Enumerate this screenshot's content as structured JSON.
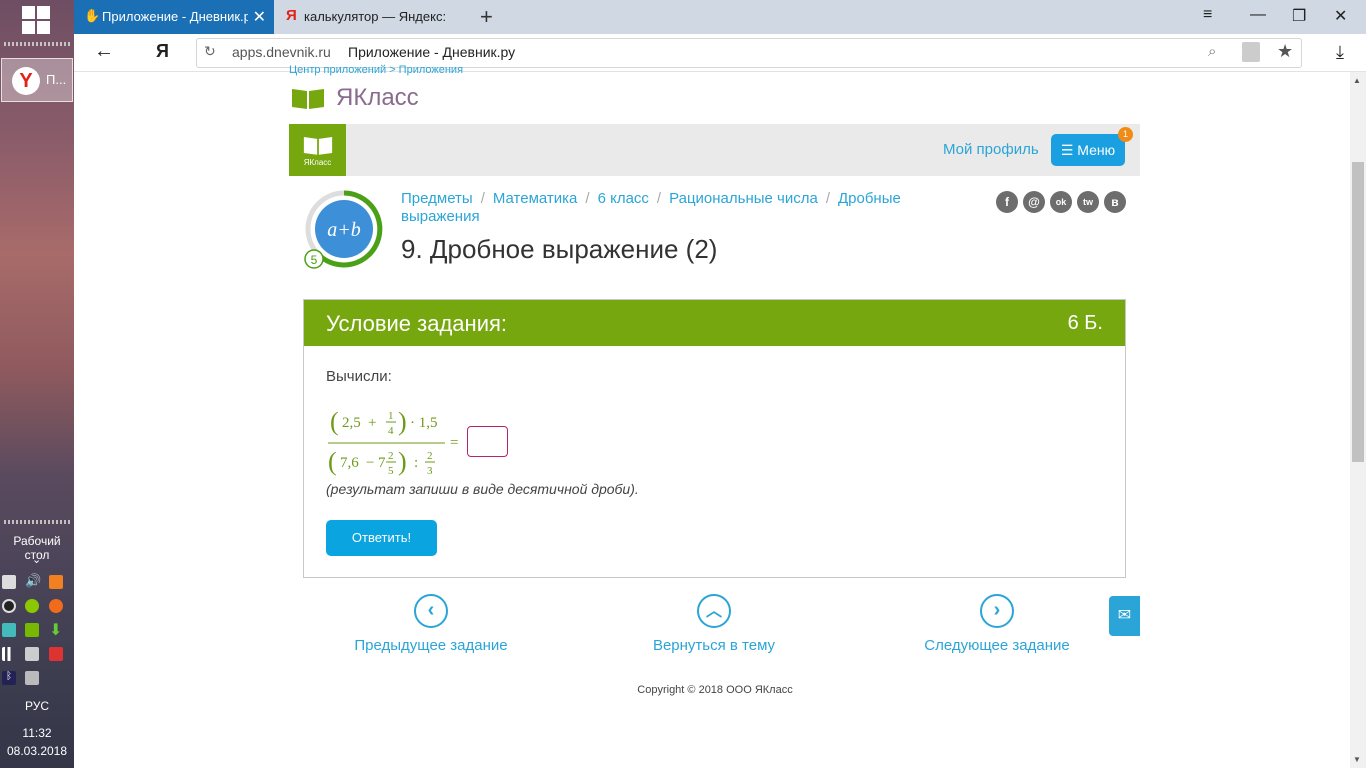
{
  "browser": {
    "tabs": [
      {
        "label": "Приложение - Дневник.р",
        "active": true
      },
      {
        "label": "калькулятор — Яндекс: на",
        "active": false
      }
    ],
    "url_host": "apps.dnevnik.ru",
    "url_title": "Приложение - Дневник.ру",
    "yandex_letter": "Я"
  },
  "taskbar": {
    "app_label": "П...",
    "desktop_label": "Рабочий стол",
    "lang": "РУС",
    "time": "11:32",
    "date": "08.03.2018"
  },
  "site": {
    "top_crumbs": "Центр приложений > Приложения",
    "brand": "ЯКласс",
    "logo_caption": "ЯКласс",
    "profile_link": "Мой профиль",
    "menu_label": "Меню",
    "menu_badge": "1",
    "progress_level": "5",
    "avatar_text": "a+b",
    "breadcrumbs": [
      "Предметы",
      "Математика",
      "6 класс",
      "Рациональные числа",
      "Дробные выражения"
    ],
    "page_title": "9. Дробное выражение (2)",
    "social": [
      "f",
      "@",
      "ok",
      "tw",
      "в"
    ]
  },
  "task": {
    "header": "Условие задания:",
    "points": "6 Б.",
    "prompt": "Вычисли:",
    "math": {
      "numerator": "(2,5 + 1/4) · 1,5",
      "denominator": "(7,6 − 7 2/5) : 2/3",
      "n_a": "2,5",
      "n_plus": "+",
      "n_frac_num": "1",
      "n_frac_den": "4",
      "n_mult": "· 1,5",
      "d_a": "7,6",
      "d_minus": "−",
      "d_whole": "7",
      "d_frac_num": "2",
      "d_frac_den": "5",
      "d_div": ":",
      "d_frac2_num": "2",
      "d_frac2_den": "3",
      "equals": "="
    },
    "answer_value": "",
    "note": "(результат запиши в виде десятичной дроби).",
    "submit": "Ответить!"
  },
  "navigation": {
    "prev": "Предыдущее задание",
    "back": "Вернуться в тему",
    "next": "Следующее задание"
  },
  "footer": {
    "copyright": "Copyright © 2018 ООО ЯКласс"
  },
  "colors": {
    "accent_green": "#76a70e",
    "link_blue": "#2ba5d7",
    "button_blue": "#0aa5e0",
    "math_green": "#6e9a1a",
    "answer_border": "#b4256b"
  }
}
